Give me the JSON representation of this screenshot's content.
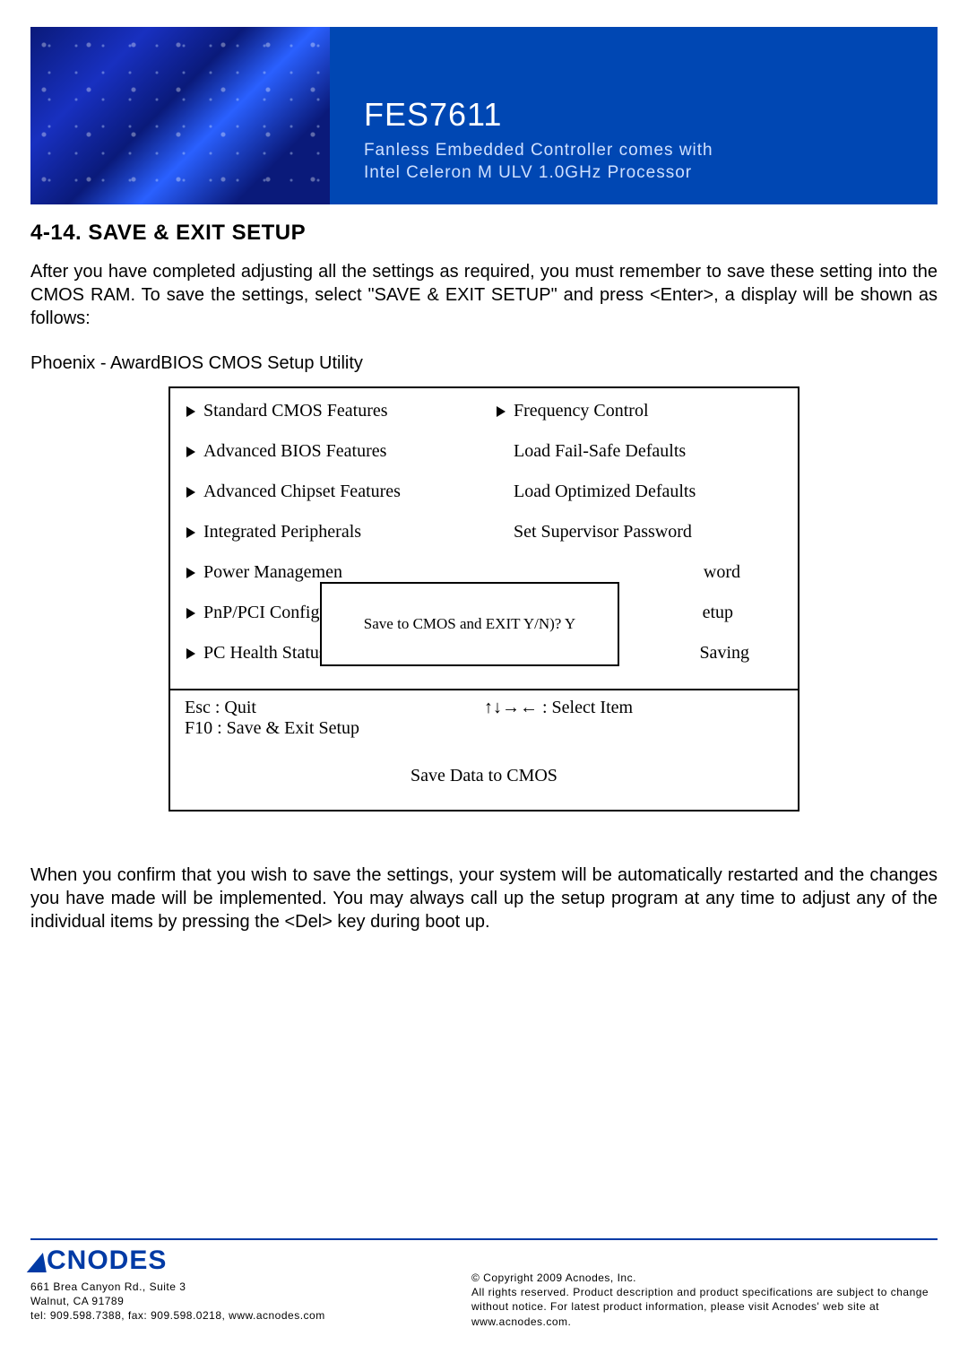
{
  "banner": {
    "title": "FES7611",
    "sub1": "Fanless Embedded Controller comes with",
    "sub2": "Intel Celeron M ULV 1.0GHz Processor"
  },
  "section_heading": "4-14. SAVE & EXIT SETUP",
  "intro_para": "After you have completed adjusting all the settings as required, you must remember to save these setting into the CMOS RAM. To save the settings, select \"SAVE & EXIT SETUP\" and press <Enter>, a display will be shown as follows:",
  "bios_caption": "Phoenix - AwardBIOS CMOS Setup Utility",
  "bios": {
    "left": [
      {
        "arrow": true,
        "label": "Standard CMOS Features"
      },
      {
        "arrow": true,
        "label": "Advanced BIOS Features"
      },
      {
        "arrow": true,
        "label": "Advanced Chipset Features"
      },
      {
        "arrow": true,
        "label": "Integrated Peripherals"
      },
      {
        "arrow": true,
        "label": "Power Managemen"
      },
      {
        "arrow": true,
        "label": "PnP/PCI Configura"
      },
      {
        "arrow": true,
        "label": "PC Health Status"
      }
    ],
    "right": [
      {
        "arrow": true,
        "label": "Frequency Control"
      },
      {
        "arrow": false,
        "label": "Load Fail-Safe Defaults"
      },
      {
        "arrow": false,
        "label": "Load Optimized Defaults"
      },
      {
        "arrow": false,
        "label": "Set Supervisor Password"
      },
      {
        "arrow": false,
        "label": "word"
      },
      {
        "arrow": false,
        "label": "etup"
      },
      {
        "arrow": false,
        "label": "Saving"
      }
    ],
    "dialog": "Save to CMOS and EXIT Y/N)? Y",
    "hint_left_1": "Esc : Quit",
    "hint_left_2": "F10 : Save & Exit Setup",
    "hint_right": "↑↓→← : Select Item",
    "footer": "Save Data to CMOS"
  },
  "outro_para": "When you confirm that you wish to save the settings, your system will be automatically restarted and the changes you have made will be implemented. You may always call up the setup program at any time to adjust any of the individual items by pressing the <Del> key during boot up.",
  "footer": {
    "logo_text": "CNODES",
    "addr_1": "661 Brea Canyon Rd., Suite 3",
    "addr_2": "Walnut, CA 91789",
    "addr_3": "tel: 909.598.7388, fax: 909.598.0218, www.acnodes.com",
    "legal_1": "© Copyright 2009 Acnodes, Inc.",
    "legal_2": "All rights reserved. Product description and product specifications are subject to change without notice. For latest product information, please visit Acnodes' web site at www.acnodes.com."
  }
}
